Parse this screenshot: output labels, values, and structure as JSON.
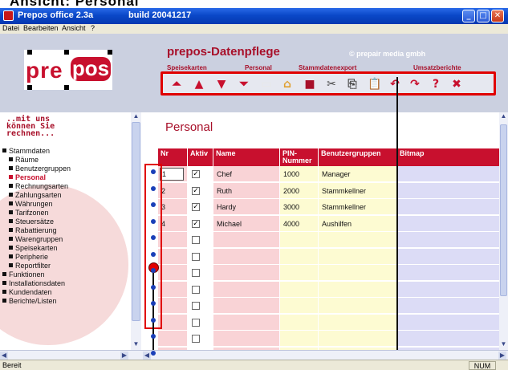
{
  "window": {
    "header_text": "Ansicht: Personal",
    "title": "Prepos office 2.3a",
    "build": "build 20041217",
    "controls": [
      "_",
      "□",
      "✕"
    ]
  },
  "menu": [
    "Datei",
    "Bearbeiten",
    "Ansicht",
    "?"
  ],
  "banner": {
    "logo_left": "pre",
    "logo_right": "pos",
    "title": "prepos-Datenpflege",
    "copyright": "© prepair media gmbh",
    "tabs": [
      "Speisekarten",
      "Personal",
      "Stammdatenexport",
      "Umsatzberichte"
    ]
  },
  "toolbar_icons": [
    {
      "name": "first-record-icon",
      "glyph": "⏶",
      "color": "#c8102e"
    },
    {
      "name": "previous-record-icon",
      "glyph": "▲",
      "color": "#c8102e"
    },
    {
      "name": "next-record-icon",
      "glyph": "▼",
      "color": "#c8102e"
    },
    {
      "name": "last-record-icon",
      "glyph": "⏷",
      "color": "#c8102e"
    },
    {
      "name": "new-document-icon",
      "glyph": "▭",
      "color": "#e8e8e8"
    },
    {
      "name": "open-folder-icon",
      "glyph": "⌂",
      "color": "#e0a030"
    },
    {
      "name": "save-icon",
      "glyph": "■",
      "color": "#a8102a"
    },
    {
      "name": "cut-icon",
      "glyph": "✂",
      "color": "#444"
    },
    {
      "name": "copy-icon",
      "glyph": "⎘",
      "color": "#444"
    },
    {
      "name": "paste-icon",
      "glyph": "📋",
      "color": "#b07020"
    },
    {
      "name": "undo-icon",
      "glyph": "↶",
      "color": "#c8102e"
    },
    {
      "name": "redo-icon",
      "glyph": "↷",
      "color": "#c8102e"
    },
    {
      "name": "help-icon",
      "glyph": "?",
      "color": "#c8102e"
    },
    {
      "name": "close-record-icon",
      "glyph": "✖",
      "color": "#c8102e"
    }
  ],
  "sidebar": {
    "motto": "..mit uns\n können Sie\n rechnen...",
    "items": [
      {
        "label": "Stammdaten",
        "level": 0,
        "active": false
      },
      {
        "label": "Räume",
        "level": 1,
        "active": false
      },
      {
        "label": "Benutzergruppen",
        "level": 1,
        "active": false
      },
      {
        "label": "Personal",
        "level": 1,
        "active": true
      },
      {
        "label": "Rechnungsarten",
        "level": 1,
        "active": false
      },
      {
        "label": "Zahlungsarten",
        "level": 1,
        "active": false
      },
      {
        "label": "Währungen",
        "level": 1,
        "active": false
      },
      {
        "label": "Tarifzonen",
        "level": 1,
        "active": false
      },
      {
        "label": "Steuersätze",
        "level": 1,
        "active": false
      },
      {
        "label": "Rabattierung",
        "level": 1,
        "active": false
      },
      {
        "label": "Warengruppen",
        "level": 1,
        "active": false
      },
      {
        "label": "Speisekarten",
        "level": 1,
        "active": false
      },
      {
        "label": "Peripherie",
        "level": 1,
        "active": false
      },
      {
        "label": "Reportfilter",
        "level": 1,
        "active": false
      },
      {
        "label": "Funktionen",
        "level": 0,
        "active": false
      },
      {
        "label": "Installationsdaten",
        "level": 0,
        "active": false
      },
      {
        "label": "Kundendaten",
        "level": 0,
        "active": false
      },
      {
        "label": "Berichte/Listen",
        "level": 0,
        "active": false
      }
    ]
  },
  "content": {
    "title": "Personal",
    "columns": [
      "Nr",
      "Aktiv",
      "Name",
      "PIN-\nNummer",
      "Benutzergruppen",
      "Bitmap"
    ],
    "rows": [
      {
        "nr": "1",
        "active": true,
        "name": "Chef",
        "pin": "1000",
        "group": "Manager",
        "bitmap": ""
      },
      {
        "nr": "2",
        "active": true,
        "name": "Ruth",
        "pin": "2000",
        "group": "Stammkellner",
        "bitmap": ""
      },
      {
        "nr": "3",
        "active": true,
        "name": "Hardy",
        "pin": "3000",
        "group": "Stammkellner",
        "bitmap": ""
      },
      {
        "nr": "4",
        "active": true,
        "name": "Michael",
        "pin": "4000",
        "group": "Aushilfen",
        "bitmap": ""
      },
      {
        "nr": "",
        "active": false,
        "name": "",
        "pin": "",
        "group": "",
        "bitmap": ""
      },
      {
        "nr": "",
        "active": false,
        "name": "",
        "pin": "",
        "group": "",
        "bitmap": ""
      },
      {
        "nr": "",
        "active": false,
        "name": "",
        "pin": "",
        "group": "",
        "bitmap": ""
      },
      {
        "nr": "",
        "active": false,
        "name": "",
        "pin": "",
        "group": "",
        "bitmap": ""
      },
      {
        "nr": "",
        "active": false,
        "name": "",
        "pin": "",
        "group": "",
        "bitmap": ""
      },
      {
        "nr": "",
        "active": false,
        "name": "",
        "pin": "",
        "group": "",
        "bitmap": ""
      },
      {
        "nr": "",
        "active": false,
        "name": "",
        "pin": "",
        "group": "",
        "bitmap": ""
      },
      {
        "nr": "",
        "active": false,
        "name": "",
        "pin": "",
        "group": "",
        "bitmap": ""
      }
    ]
  },
  "status": {
    "text": "Bereit",
    "num": "NUM"
  }
}
